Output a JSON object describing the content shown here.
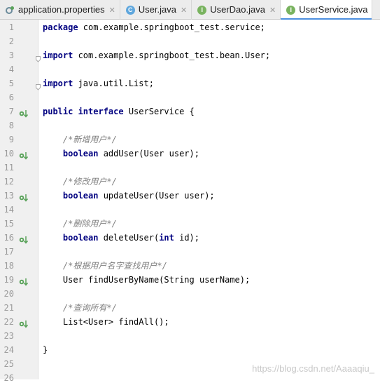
{
  "tabs": [
    {
      "label": "application.properties",
      "icon": "properties-file-icon",
      "active": false
    },
    {
      "label": "User.java",
      "icon": "class-icon",
      "icon_letter": "C",
      "active": false
    },
    {
      "label": "UserDao.java",
      "icon": "interface-icon",
      "icon_letter": "I",
      "active": false
    },
    {
      "label": "UserService.java",
      "icon": "interface-icon",
      "icon_letter": "I",
      "active": true
    }
  ],
  "colors": {
    "keyword": "#000080",
    "comment": "#808080",
    "class_icon": "#5fa7dd",
    "interface_icon": "#79b35f",
    "active_tab_underline": "#4d8fe0",
    "gutter_marker": "#5aa25a"
  },
  "lines": [
    {
      "n": "1",
      "segments": [
        {
          "t": "package",
          "c": "kw"
        },
        {
          "t": " com.example.springboot_test.service;"
        }
      ]
    },
    {
      "n": "2",
      "segments": []
    },
    {
      "n": "3",
      "segments": [
        {
          "t": "import",
          "c": "kw"
        },
        {
          "t": " com.example.springboot_test.bean.User;"
        }
      ],
      "fold": true
    },
    {
      "n": "4",
      "segments": []
    },
    {
      "n": "5",
      "segments": [
        {
          "t": "import",
          "c": "kw"
        },
        {
          "t": " java.util.List;"
        }
      ],
      "fold": true
    },
    {
      "n": "6",
      "segments": []
    },
    {
      "n": "7",
      "segments": [
        {
          "t": "public interface",
          "c": "kw"
        },
        {
          "t": " UserService {"
        }
      ],
      "marker": true
    },
    {
      "n": "8",
      "segments": []
    },
    {
      "n": "9",
      "segments": [
        {
          "t": "    /*新增用户*/",
          "c": "cm"
        }
      ]
    },
    {
      "n": "10",
      "segments": [
        {
          "t": "    "
        },
        {
          "t": "boolean",
          "c": "kw"
        },
        {
          "t": " addUser(User user);"
        }
      ],
      "marker": true
    },
    {
      "n": "11",
      "segments": []
    },
    {
      "n": "12",
      "segments": [
        {
          "t": "    /*修改用户*/",
          "c": "cm"
        }
      ]
    },
    {
      "n": "13",
      "segments": [
        {
          "t": "    "
        },
        {
          "t": "boolean",
          "c": "kw"
        },
        {
          "t": " updateUser(User user);"
        }
      ],
      "marker": true
    },
    {
      "n": "14",
      "segments": []
    },
    {
      "n": "15",
      "segments": [
        {
          "t": "    /*删除用户*/",
          "c": "cm"
        }
      ]
    },
    {
      "n": "16",
      "segments": [
        {
          "t": "    "
        },
        {
          "t": "boolean",
          "c": "kw"
        },
        {
          "t": " deleteUser("
        },
        {
          "t": "int",
          "c": "kw"
        },
        {
          "t": " id);"
        }
      ],
      "marker": true
    },
    {
      "n": "17",
      "segments": []
    },
    {
      "n": "18",
      "segments": [
        {
          "t": "    /*根据用户名字查找用户*/",
          "c": "cm"
        }
      ]
    },
    {
      "n": "19",
      "segments": [
        {
          "t": "    User findUserByName(String userName);"
        }
      ],
      "marker": true
    },
    {
      "n": "20",
      "segments": []
    },
    {
      "n": "21",
      "segments": [
        {
          "t": "    /*查询所有*/",
          "c": "cm"
        }
      ]
    },
    {
      "n": "22",
      "segments": [
        {
          "t": "    List<User> findAll();"
        }
      ],
      "marker": true
    },
    {
      "n": "23",
      "segments": []
    },
    {
      "n": "24",
      "segments": [
        {
          "t": "}"
        }
      ]
    },
    {
      "n": "25",
      "segments": []
    },
    {
      "n": "26",
      "segments": []
    }
  ],
  "watermark": "https://blog.csdn.net/Aaaaqiu_"
}
